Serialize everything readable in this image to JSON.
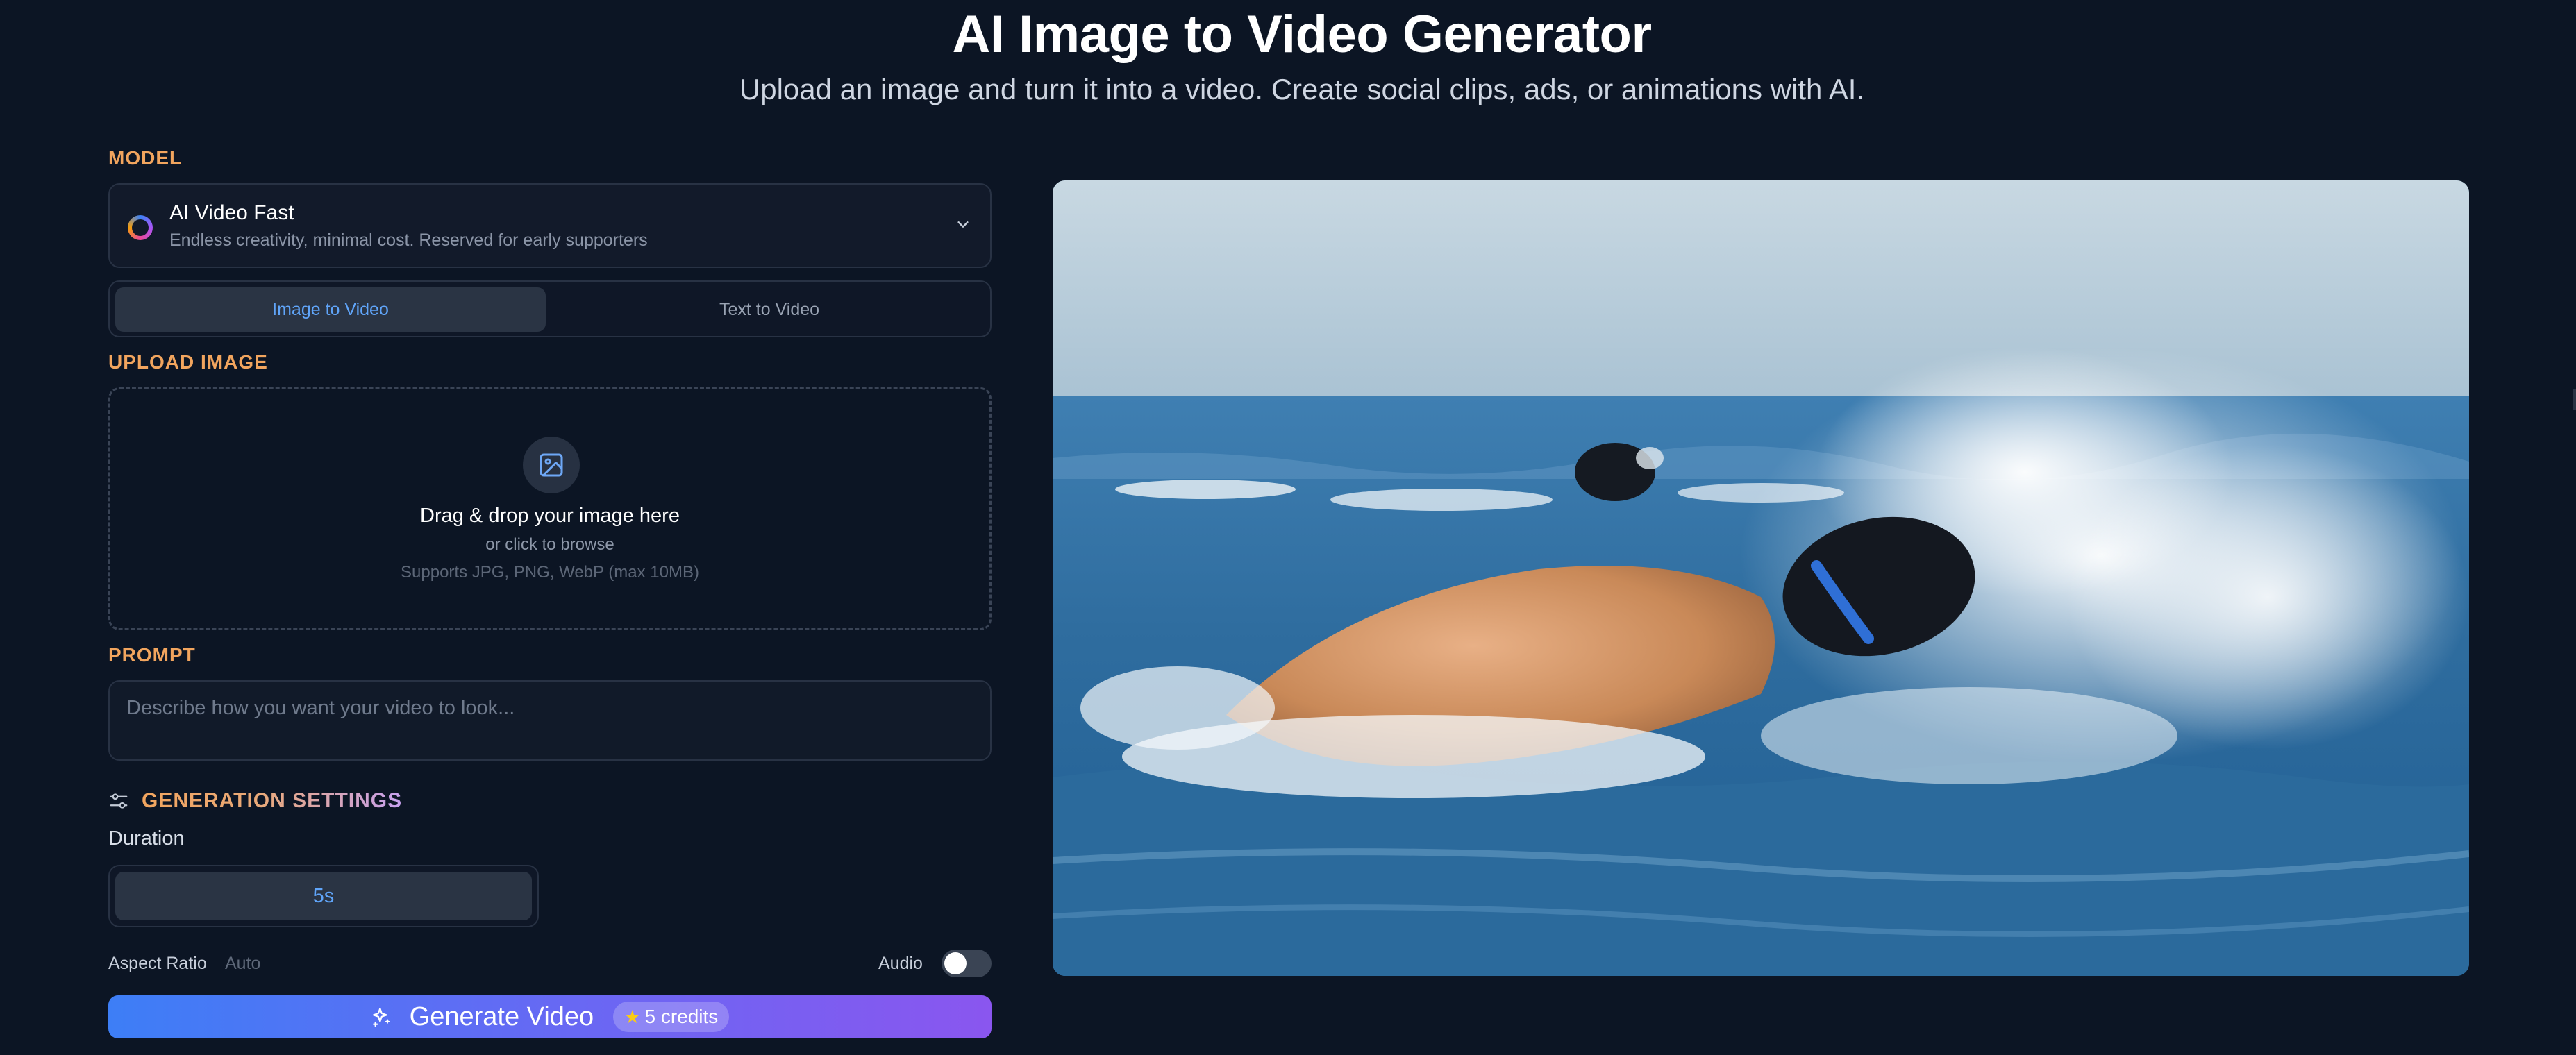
{
  "header": {
    "title": "AI Image to Video Generator",
    "subtitle": "Upload an image and turn it into a video. Create social clips, ads, or animations with AI."
  },
  "model": {
    "label": "MODEL",
    "name": "AI Video Fast",
    "description": "Endless creativity, minimal cost. Reserved for early supporters",
    "icon": "model-logo-icon"
  },
  "mode_tabs": {
    "tabs": [
      {
        "label": "Image to Video",
        "active": true
      },
      {
        "label": "Text to Video",
        "active": false
      }
    ]
  },
  "upload": {
    "label": "UPLOAD IMAGE",
    "main_text": "Drag & drop your image here",
    "sub_text": "or click to browse",
    "note": "Supports JPG, PNG, WebP (max 10MB)",
    "icon": "image-icon"
  },
  "prompt": {
    "label": "PROMPT",
    "placeholder": "Describe how you want your video to look...",
    "value": ""
  },
  "settings": {
    "title": "GENERATION SETTINGS",
    "icon": "sliders-icon",
    "duration_label": "Duration",
    "duration_options": [
      "5s"
    ],
    "duration_selected": "5s",
    "aspect_ratio_label": "Aspect Ratio",
    "aspect_ratio_value": "Auto",
    "audio_label": "Audio",
    "audio_enabled": false
  },
  "generate": {
    "label": "Generate Video",
    "credits": "5 credits",
    "icon": "sparkles-icon"
  },
  "preview": {
    "description_icon": "video-preview"
  },
  "colors": {
    "background": "#0c1524",
    "accent_label": "#f2a55e",
    "active_tab_text": "#60a5fa",
    "button_gradient_start": "#3d7ef6",
    "button_gradient_end": "#8a56ef"
  }
}
